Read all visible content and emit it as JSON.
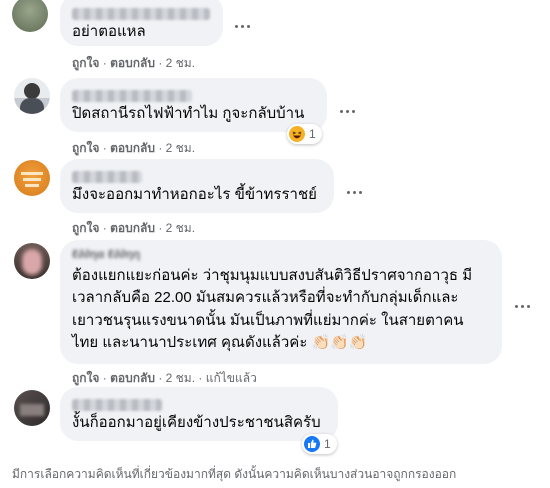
{
  "comments": [
    {
      "text": "อย่าตอแหล",
      "actions": {
        "like": "ถูกใจ",
        "reply": "ตอบกลับ",
        "time": "2 ชม."
      }
    },
    {
      "text": "ปิดสถานีรถไฟฟ้าทำไม กูจะกลับบ้าน",
      "actions": {
        "like": "ถูกใจ",
        "reply": "ตอบกลับ",
        "time": "2 ชม."
      },
      "reaction": {
        "icon": "haha-emoji-icon",
        "count": "1"
      }
    },
    {
      "text": "มึงจะออกมาทำหอกอะไร ขี้ข้าทรราชย์",
      "actions": {
        "like": "ถูกใจ",
        "reply": "ตอบกลับ",
        "time": "2 ชม."
      }
    },
    {
      "lines": [
        "ต้องแยกแยะก่อนค่ะ ว่าชุมนุมแบบสงบสันติวิธีปราศจากอาวุธ มี",
        "เวลากลับคือ 22.00 มันสมควรแล้วหรือที่จะทำกับกลุ่มเด็กและ",
        "เยาวชนรุนแรงขนาดนั้น มันเป็นภาพที่แย่มากค่ะ ในสายตาคน",
        "ไทย และนานาประเทศ คุณดังแล้วค่ะ 👏🏻👏🏻👏🏻"
      ],
      "actions": {
        "like": "ถูกใจ",
        "reply": "ตอบกลับ",
        "time": "2 ชม.",
        "edited": "แก้ไขแล้ว"
      }
    },
    {
      "text": "งั้นก็ออกมาอยู่เคียงข้างประชาชนสิครับ",
      "actions": {
        "like": "ถูกใจ",
        "reply": "ตอบกลับ",
        "time": "2 ชม."
      },
      "reaction": {
        "icon": "like-icon",
        "count": "1"
      }
    }
  ],
  "footer": "มีการเลือกความคิดเห็นที่เกี่ยวข้องมากที่สุด ดังนั้นความคิดเห็นบางส่วนอาจถูกกรองออก",
  "colors": {
    "bubble": "#f0f2f5",
    "meta": "#65676b",
    "like_blue": "#1877f2",
    "haha_yellow": "#f7b125"
  }
}
